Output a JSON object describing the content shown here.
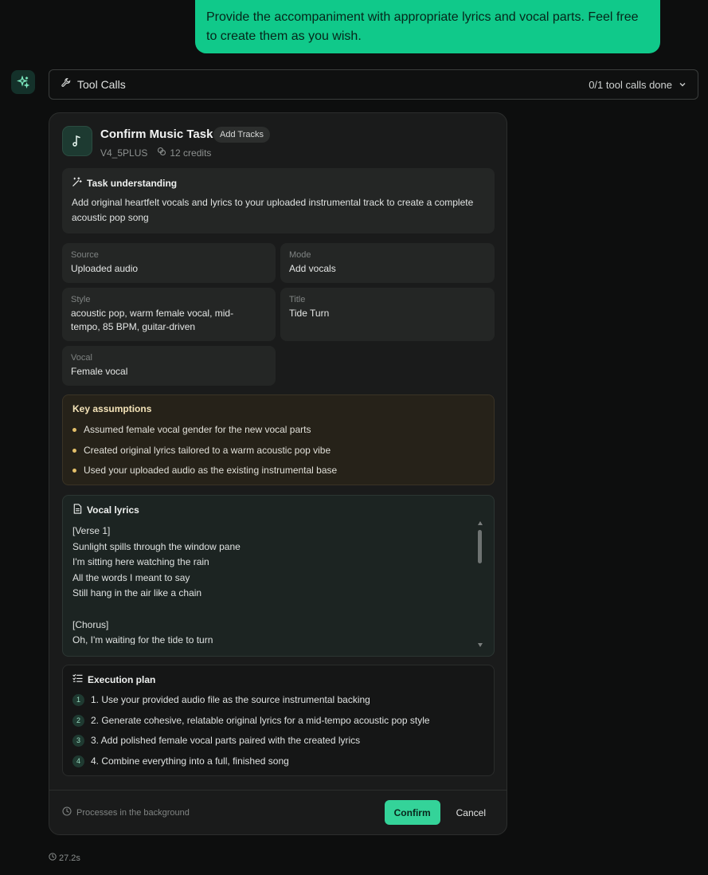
{
  "user_message": "Provide the accompaniment with appropriate lyrics and vocal parts. Feel free to create them as you wish.",
  "tool_calls": {
    "title": "Tool Calls",
    "status": "0/1 tool calls done"
  },
  "card": {
    "title": "Confirm Music Task",
    "badge": "Add Tracks",
    "model": "V4_5PLUS",
    "credits": "12 credits",
    "understanding": {
      "heading": "Task understanding",
      "text": "Add original heartfelt vocals and lyrics to your uploaded instrumental track to create a complete acoustic pop song"
    },
    "fields": {
      "source": {
        "label": "Source",
        "value": "Uploaded audio"
      },
      "mode": {
        "label": "Mode",
        "value": "Add vocals"
      },
      "style": {
        "label": "Style",
        "value": "acoustic pop, warm female vocal, mid-tempo, 85 BPM, guitar-driven"
      },
      "title": {
        "label": "Title",
        "value": "Tide Turn"
      },
      "vocal": {
        "label": "Vocal",
        "value": "Female vocal"
      }
    },
    "assumptions": {
      "heading": "Key assumptions",
      "items": [
        "Assumed female vocal gender for the new vocal parts",
        "Created original lyrics tailored to a warm acoustic pop vibe",
        "Used your uploaded audio as the existing instrumental base"
      ]
    },
    "lyrics": {
      "heading": "Vocal lyrics",
      "text": "[Verse 1]\nSunlight spills through the window pane\nI'm sitting here watching the rain\nAll the words I meant to say\nStill hang in the air like a chain\n\n[Chorus]\nOh, I'm waiting for the tide to turn"
    },
    "plan": {
      "heading": "Execution plan",
      "steps": [
        {
          "num": "1",
          "text": "1. Use your provided audio file as the source instrumental backing"
        },
        {
          "num": "2",
          "text": "2. Generate cohesive, relatable original lyrics for a mid-tempo acoustic pop style"
        },
        {
          "num": "3",
          "text": "3. Add polished female vocal parts paired with the created lyrics"
        },
        {
          "num": "4",
          "text": "4. Combine everything into a full, finished song"
        }
      ]
    },
    "footer": {
      "note": "Processes in the background",
      "confirm": "Confirm",
      "cancel": "Cancel"
    }
  },
  "elapsed": "27.2s",
  "colors": {
    "accent": "#34d399",
    "user_bubble": "#10c98a",
    "background": "#0d0e0e",
    "card": "#1a1b1b"
  }
}
